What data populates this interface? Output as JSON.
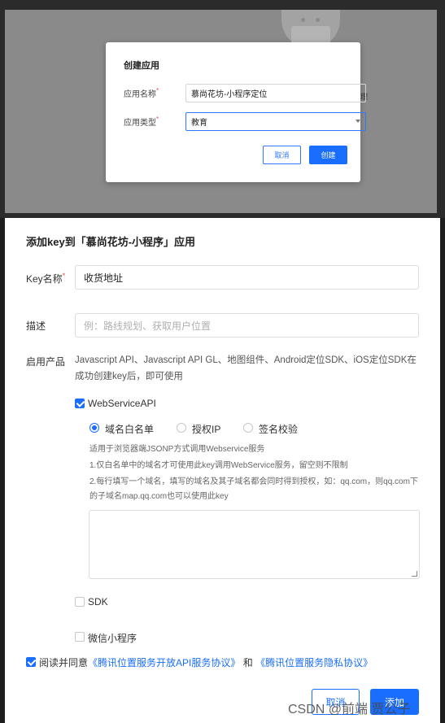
{
  "create_modal": {
    "title": "创建应用",
    "name_label": "应用名称",
    "name_value": "慕尚花坊-小程序定位",
    "type_label": "应用类型",
    "type_value": "教育",
    "cancel_label": "取消",
    "create_label": "创建"
  },
  "side_mark": "理",
  "form": {
    "title": "添加key到「慕尚花坊-小程序」应用",
    "key_label": "Key名称",
    "key_value": "收货地址",
    "desc_label": "描述",
    "desc_placeholder": "例：路线规划、获取用户位置",
    "products_label": "启用产品",
    "products_text": "Javascript API、Javascript API GL、地图组件、Android定位SDK、iOS定位SDK在成功创建key后，即可使用",
    "webservice_label": "WebServiceAPI",
    "radio_options": [
      "域名白名单",
      "授权IP",
      "签名校验"
    ],
    "help_lines": [
      "适用于浏览器端JSONP方式调用Webservice服务",
      "1.仅白名单中的域名才可使用此key调用WebService服务，留空则不限制",
      "2.每行填写一个域名，填写的域名及其子域名都会同时得到授权，如：qq.com，则qq.com下的子域名map.qq.com也可以使用此key"
    ],
    "sdk_label": "SDK",
    "miniprogram_label": "微信小程序",
    "agree_text": "阅读并同意",
    "agree_link1": "《腾讯位置服务开放API服务协议》",
    "agree_and": "和",
    "agree_link2": "《腾讯位置服务隐私协议》",
    "cancel_label": "取消",
    "ok_label": "添加"
  },
  "watermark": "CSDN @前端 贾公子",
  "colors": {
    "accent": "#1a6eff",
    "required": "#e34d59"
  }
}
